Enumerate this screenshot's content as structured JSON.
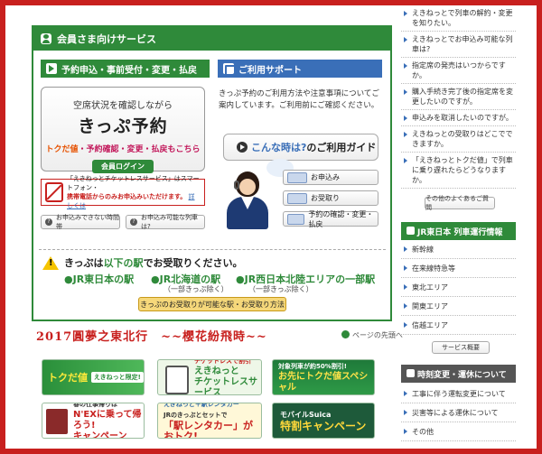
{
  "members": {
    "title": "会員さま向けサービス",
    "tab_reserve": "予約申込・事前受付・変更・払戻",
    "tab_support": "ご利用サポート",
    "kippu_sub": "空席状況を確認しながら",
    "kippu_main": "きっぷ予約",
    "kippu_note_a": "トクだ値",
    "kippu_note_b": "・予約確認・変更・払戻もこちら",
    "login": "会員ログイン",
    "sp_line1a": "「えきねっとチケットレスサービス」",
    "sp_line1b": "はスマートフォン・",
    "sp_line2": "携帯電話からのみお申込みいただけます。",
    "sp_more": "詳しくは",
    "btn_unavailable": "お申込みできない時間帯",
    "btn_trains": "お申込み可能な列車は?",
    "support_text": "きっぷ予約のご利用方法や注意事項についてご案内しています。ご利用前にご確認ください。",
    "guide_a": "こんな時は?",
    "guide_b": "のご利用ガイド",
    "guide_items": [
      "お申込み",
      "お受取り",
      "予約の確認・変更・払戻"
    ],
    "stations_title_a": "きっぷは",
    "stations_title_hl": "以下の駅",
    "stations_title_b": "でお受取りください。",
    "st_jre": "●JR東日本の駅",
    "st_jrh": "●JR北海道の駅",
    "st_jrh_sub": "（一部きっぷ除く）",
    "st_jrw": "●JR西日本北陸エリアの一部駅",
    "st_jrw_sub": "（一部きっぷ除く）",
    "st_btn": "きっぷのお受取りが可能な駅・お受取り方法"
  },
  "caption": "2017圓夢之東北行　~~櫻花紛飛時~~",
  "page_top": "ページの先頭へ",
  "banners": {
    "b1a": "トクだ値",
    "b1b": "えきねっと限定!",
    "b2a": "チケットレスで割引",
    "b2b": "えきねっと",
    "b2c": "チケットレスサービス",
    "b3a": "対象列車が約50%割引!",
    "b3b": "お先にトクだ値スペシャル",
    "b4a": "春の仕事帰りは",
    "b4b": "N'EXに乗って帰ろう!",
    "b4c": "キャンペーン",
    "b5a": "えきねっと＋駅レンタカー",
    "b5b": "JRのきっぷとセットで",
    "b5c": "「駅レンタカー」がおトク!",
    "b6a": "モバイルSuica",
    "b6b": "特割キャンペーン"
  },
  "faq": [
    "えきねっとで列車の解約・変更を知りたい。",
    "えきねっとでお申込み可能な列車は?",
    "指定席の発売はいつからですか。",
    "購入手続き完了後の指定席を変更したいのですが。",
    "申込みを取消したいのですが。",
    "えきねっとの受取りはどこでできますか。",
    "「えきねっとトクだ値」で列車に乗り遅れたらどうなりますか。"
  ],
  "faq_more": "その他のよくあるご質問",
  "train_info": {
    "title": "JR東日本 列車運行情報",
    "items": [
      "新幹線",
      "在来線特急等",
      "東北エリア",
      "関東エリア",
      "信越エリア"
    ],
    "button": "サービス概要"
  },
  "schedule": {
    "title": "時刻変更・運休について",
    "items": [
      "工事に伴う運転変更について",
      "災害等による運休について",
      "その他"
    ]
  }
}
